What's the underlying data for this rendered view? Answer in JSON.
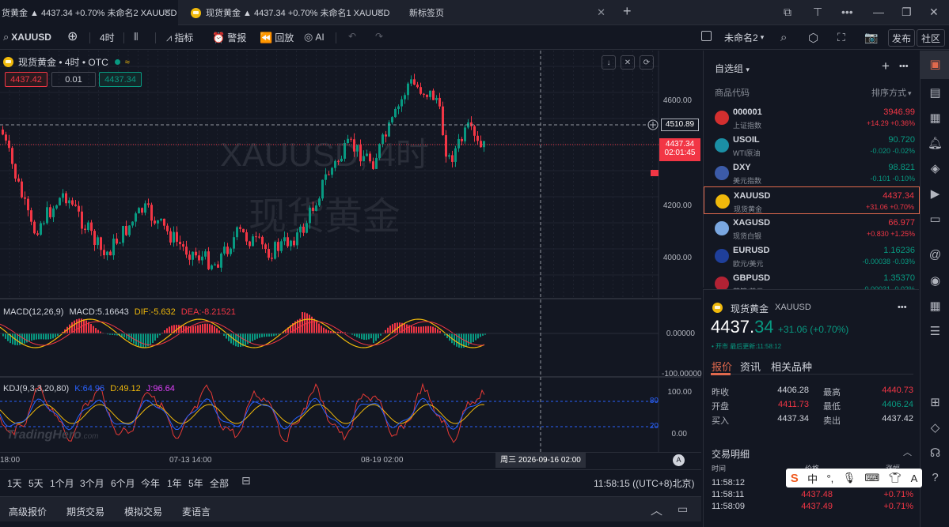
{
  "tabs": [
    {
      "label": "货黄金 ▲ 4437.34 +0.70% 未命名2 XAUUSD"
    },
    {
      "label": "现货黄金 ▲ 4437.34 +0.70% 未命名1 XAUUSD"
    },
    {
      "label": "新标签页"
    }
  ],
  "toolbar": {
    "symbol": "XAUUSD",
    "interval": "4时",
    "indicators": "指标",
    "alerts": "警报",
    "replay": "回放",
    "ai": "AI",
    "layout_name": "未命名2",
    "publish": "发布",
    "community": "社区"
  },
  "chart": {
    "title": "现货黄金 • 4时 • OTC",
    "bid": "4437.42",
    "qty": "0.01",
    "ask": "4437.34",
    "watermark_symbol": "XAUUSD, 4时",
    "watermark_name": "现货黄金",
    "last_price": "4437.34",
    "countdown": "02:01:45",
    "crosshair_price": "4510.89",
    "price_ticks": [
      "4600.00",
      "4400.00",
      "4200.00",
      "4000.00"
    ],
    "macd_legend": {
      "name": "MACD(12,26,9)",
      "macd": "MACD:5.16643",
      "dif": "DIF:-5.632",
      "dea": "DEA:-8.21521"
    },
    "macd_ticks": [
      "0.00000",
      "-100.00000"
    ],
    "kdj_legend": {
      "name": "KDJ(9,3,3,20,80)",
      "k": "K:64.96",
      "d": "D:49.12",
      "j": "J:96.64"
    },
    "kdj_ticks": [
      "100.00",
      "80",
      "20",
      "0.00"
    ],
    "time_ticks": [
      "18:00",
      "07-13 14:00",
      "08-19 02:00"
    ],
    "crosshair_time": "周三 2026-09-16  02:00",
    "brand": "TradingHero",
    "brand_suffix": ".com",
    "auto_label": "A"
  },
  "ranges": [
    "1天",
    "5天",
    "1个月",
    "3个月",
    "6个月",
    "今年",
    "1年",
    "5年",
    "全部"
  ],
  "clock": "11:58:15 ((UTC+8)北京)",
  "bottom_tabs": [
    "高级报价",
    "期货交易",
    "模拟交易",
    "麦语言"
  ],
  "watchlist": {
    "title": "自选组",
    "col_code": "商品代码",
    "col_sort": "排序方式",
    "items": [
      {
        "symbol": "000001",
        "name": "上证指数",
        "price": "3946.99",
        "change": "+14.29",
        "pct": "+0.36%",
        "dir": "up",
        "color": "#d32f2f"
      },
      {
        "symbol": "USOIL",
        "name": "WTI原油",
        "price": "90.720",
        "change": "-0.020",
        "pct": "-0.02%",
        "dir": "down",
        "color": "#1b8fa5"
      },
      {
        "symbol": "DXY",
        "name": "美元指数",
        "price": "98.821",
        "change": "-0.101",
        "pct": "-0.10%",
        "dir": "down",
        "color": "#3c5ba8"
      },
      {
        "symbol": "XAUUSD",
        "name": "现货黄金",
        "price": "4437.34",
        "change": "+31.06",
        "pct": "+0.70%",
        "dir": "up",
        "color": "#f0b90b"
      },
      {
        "symbol": "XAGUSD",
        "name": "现货白银",
        "price": "66.977",
        "change": "+0.830",
        "pct": "+1.25%",
        "dir": "up",
        "color": "#7aa7e0"
      },
      {
        "symbol": "EURUSD",
        "name": "欧元/美元",
        "price": "1.16236",
        "change": "-0.00038",
        "pct": "-0.03%",
        "dir": "down",
        "color": "#1f3f9a"
      },
      {
        "symbol": "GBPUSD",
        "name": "英镑/美元",
        "price": "1.35370",
        "change": "-0.00031",
        "pct": "-0.02%",
        "dir": "down",
        "color": "#b22234"
      }
    ]
  },
  "detail": {
    "name": "现货黄金",
    "symbol": "XAUUSD",
    "price_int": "4437.",
    "price_dec": "34",
    "change": "+31.06 (+0.70%)",
    "status": "• 开市 最后更新:11:58:12",
    "tabs": [
      "报价",
      "资讯",
      "相关品种"
    ],
    "quote": {
      "prev_close_label": "昨收",
      "prev_close": "4406.28",
      "high_label": "最高",
      "high": "4440.73",
      "open_label": "开盘",
      "open": "4411.73",
      "low_label": "最低",
      "low": "4406.24",
      "buy_label": "买入",
      "buy": "4437.34",
      "sell_label": "卖出",
      "sell": "4437.42"
    },
    "trades_title": "交易明细",
    "trade_cols": [
      "时间",
      "价格",
      "涨幅"
    ],
    "trades": [
      {
        "time": "11:58:12",
        "price": "4437.51",
        "pct": "+0.71%"
      },
      {
        "time": "11:58:11",
        "price": "4437.48",
        "pct": "+0.71%"
      },
      {
        "time": "11:58:09",
        "price": "4437.49",
        "pct": "+0.71%"
      }
    ]
  },
  "ime": [
    "中",
    "°,",
    "☰"
  ],
  "colors": {
    "up": "#f23645",
    "down": "#089981",
    "accent": "#e0694d",
    "bg": "#131722"
  }
}
